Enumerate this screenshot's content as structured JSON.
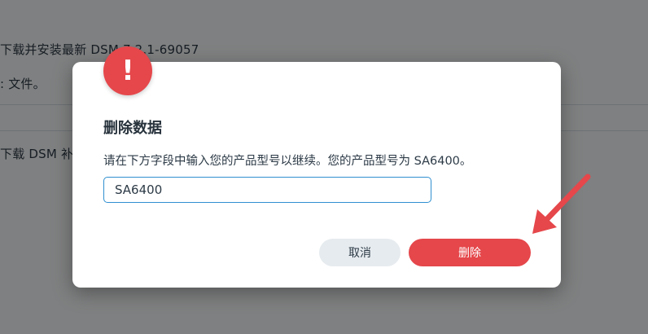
{
  "background": {
    "line1": "下载并安装最新 DSM 7.2.1-69057",
    "line2": ": 文件。",
    "line3": "下载 DSM 补"
  },
  "dialog": {
    "icon": "alert-exclamation-icon",
    "icon_glyph": "!",
    "title": "删除数据",
    "description": "请在下方字段中输入您的产品型号以继续。您的产品型号为 SA6400。",
    "input_value": "SA6400",
    "cancel_label": "取消",
    "delete_label": "删除"
  },
  "annotation": {
    "arrow_icon": "red-pointer-arrow-icon"
  },
  "colors": {
    "danger": "#e5474b",
    "input_border": "#2f8fd0",
    "cancel_bg": "#e6ebef",
    "overlay": "rgba(0,0,0,0.48)"
  }
}
